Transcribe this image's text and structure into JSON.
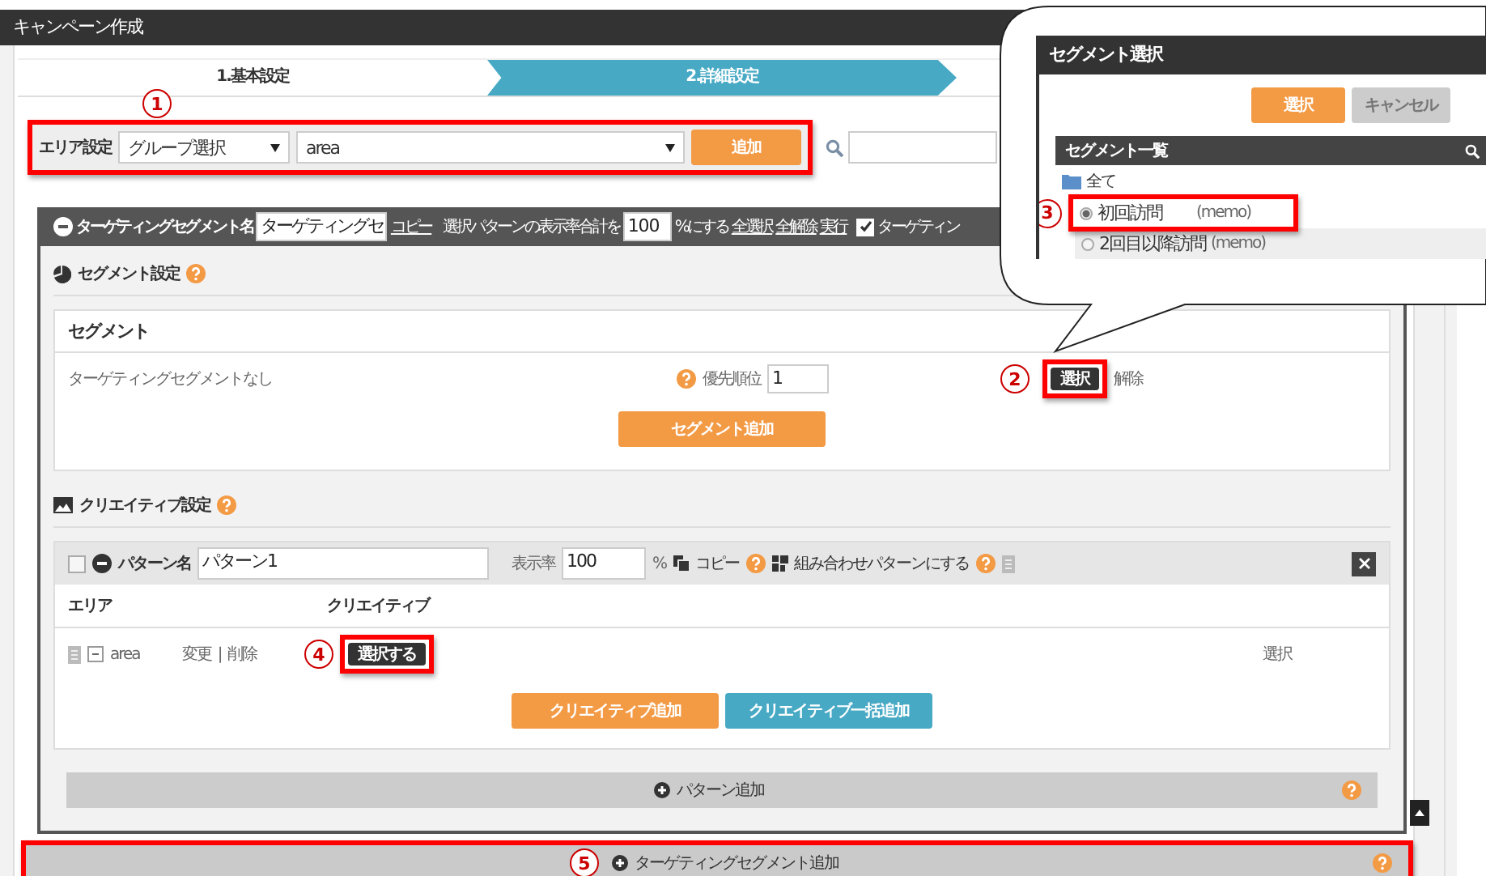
{
  "window": {
    "title": "キャンペーン作成"
  },
  "steps": [
    {
      "label": "1.基本設定",
      "selected": false
    },
    {
      "label": "2.詳細設定",
      "selected": true
    }
  ],
  "area_setting": {
    "callout": "1",
    "label": "エリア設定",
    "group_select": "グループ選択",
    "area_select": "area",
    "add_button": "追加"
  },
  "segment_bar": {
    "label": "ターゲティングセグメント名",
    "name_value": "ターゲティングセ",
    "copy": "コピー",
    "ratio_label": "選択パターンの表示率合計を",
    "ratio_value": "100",
    "ratio_suffix": "%にする",
    "links": [
      "全選択",
      "全解除",
      "実行"
    ],
    "checked": true,
    "checkbox_label": "ターゲティン"
  },
  "segment_settings": {
    "title": "セグメント設定",
    "table_header": "セグメント",
    "row_text": "ターゲティングセグメントなし",
    "priority_label": "優先順位",
    "priority_value": "1",
    "callout": "2",
    "select_button": "選択",
    "release": "解除",
    "add_button": "セグメント追加"
  },
  "creative_settings": {
    "title": "クリエイティブ設定",
    "pattern": {
      "checked": false,
      "name_label": "パターン名",
      "name_value": "パターン1",
      "rate_label": "表示率",
      "rate_value": "100",
      "rate_suffix": "%",
      "copy": "コピー",
      "combine": "組み合わせパターンにする"
    },
    "columns": [
      "エリア",
      "クリエイティブ"
    ],
    "row": {
      "area": "area",
      "change": "変更",
      "separator": "|",
      "delete": "削除",
      "callout": "4",
      "select_button": "選択する",
      "right_text": "選択"
    },
    "buttons": [
      {
        "label": "クリエイティブ追加",
        "kind": "primary"
      },
      {
        "label": "クリエイティブ一括追加",
        "kind": "secondary"
      }
    ],
    "add_pattern": "パターン追加"
  },
  "add_segment": {
    "callout": "5",
    "label": "ターゲティングセグメント追加"
  },
  "popup": {
    "title": "セグメント選択",
    "buttons": [
      {
        "label": "選択",
        "kind": "primary"
      },
      {
        "label": "キャンセル",
        "kind": "cancel"
      }
    ],
    "list_title": "セグメント一覧",
    "folder": "全て",
    "items": [
      {
        "callout": "3",
        "name": "初回訪問",
        "memo": "(memo)",
        "selected": true
      },
      {
        "name": "2回目以降訪問",
        "memo": "(memo)",
        "selected": false
      }
    ]
  }
}
